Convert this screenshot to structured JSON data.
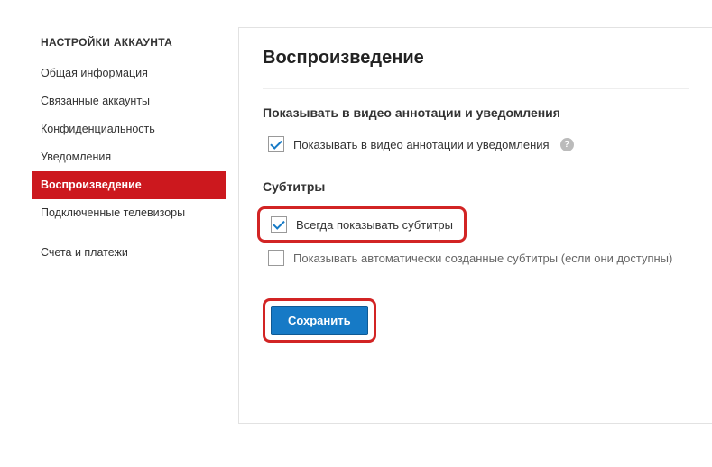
{
  "sidebar": {
    "header": "НАСТРОЙКИ АККАУНТА",
    "items": [
      {
        "label": "Общая информация",
        "active": false
      },
      {
        "label": "Связанные аккаунты",
        "active": false
      },
      {
        "label": "Конфиденциальность",
        "active": false
      },
      {
        "label": "Уведомления",
        "active": false
      },
      {
        "label": "Воспроизведение",
        "active": true
      },
      {
        "label": "Подключенные телевизоры",
        "active": false
      },
      {
        "label": "Счета и платежи",
        "active": false
      }
    ]
  },
  "main": {
    "title": "Воспроизведение",
    "section1": {
      "title": "Показывать в видео аннотации и уведомления",
      "checkbox_label": "Показывать в видео аннотации и уведомления",
      "help": "?"
    },
    "section2": {
      "title": "Субтитры",
      "checkbox1_label": "Всегда показывать субтитры",
      "checkbox2_label": "Показывать автоматически созданные субтитры (если они доступны)"
    },
    "save_button": "Сохранить"
  }
}
